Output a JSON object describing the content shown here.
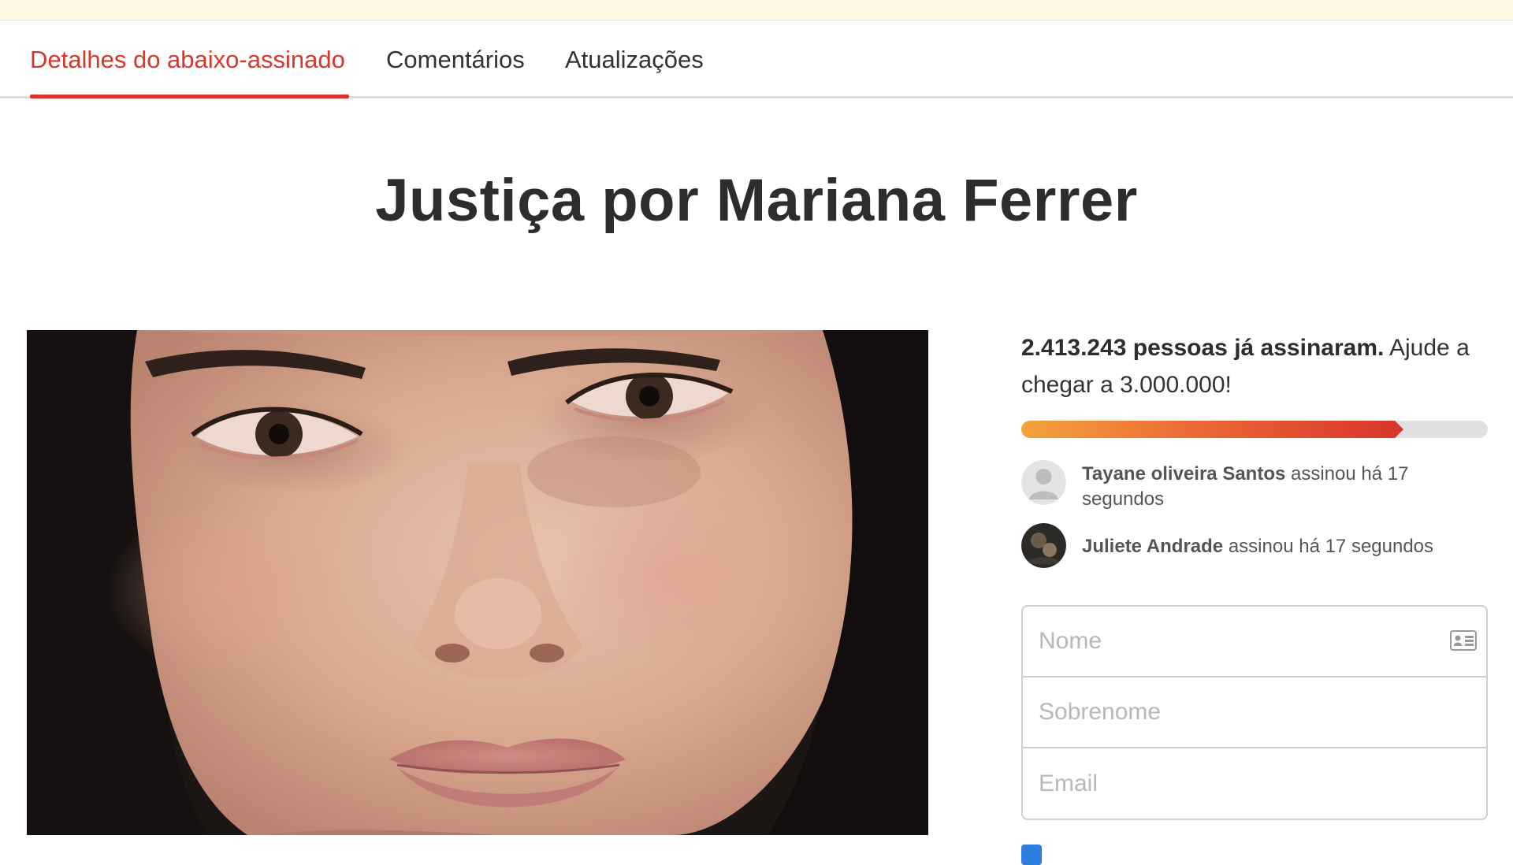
{
  "tabs": [
    {
      "label": "Detalhes do abaixo-assinado",
      "active": true
    },
    {
      "label": "Comentários",
      "active": false
    },
    {
      "label": "Atualizações",
      "active": false
    }
  ],
  "title": "Justiça por Mariana Ferrer",
  "hero_image": {
    "alt": "Foto de Mariana Ferrer"
  },
  "signatures": {
    "count_bold": "2.413.243 pessoas já assinaram.",
    "count_rest": " Ajude a chegar a 3.000.000!",
    "current": 2413243,
    "goal": 3000000,
    "progress_fraction": 0.82
  },
  "recent_signers": [
    {
      "name": "Tayane oliveira Santos",
      "action": " assinou há 17 segundos",
      "avatar": "default-avatar-icon"
    },
    {
      "name": "Juliete Andrade",
      "action": " assinou há 17 segundos",
      "avatar": "photo-avatar"
    }
  ],
  "form": {
    "first_name_placeholder": "Nome",
    "last_name_placeholder": "Sobrenome",
    "email_placeholder": "Email",
    "name_field_icon": "contact-card-icon"
  },
  "colors": {
    "accent": "#d9362b",
    "progress_start": "#f2a33c",
    "progress_end": "#d9362b",
    "checkbox": "#2b7de0"
  }
}
